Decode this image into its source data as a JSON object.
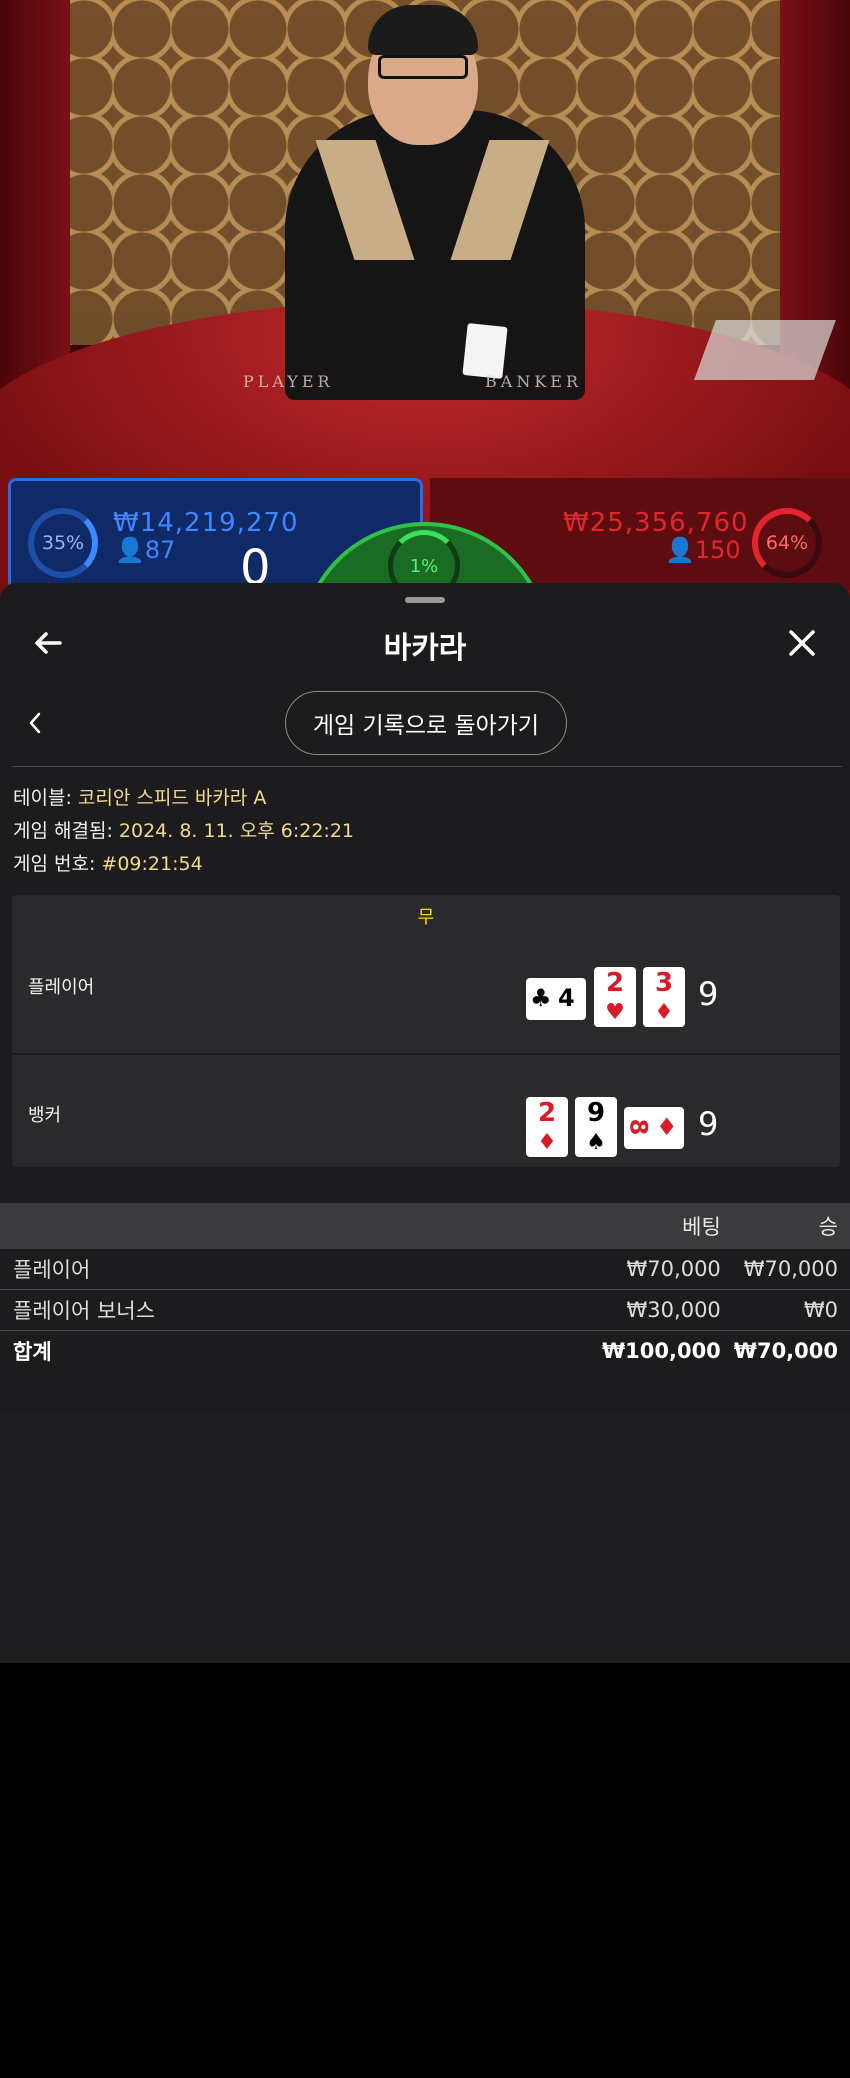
{
  "scene": {
    "felt_player": "PLAYER",
    "felt_banker": "BANKER"
  },
  "bet_strip": {
    "player_pct": "35%",
    "player_amount": "₩14,219,270",
    "player_count": "87",
    "player_score": "0",
    "tie_pct": "1%",
    "banker_amount": "₩25,356,760",
    "banker_count": "150",
    "banker_pct": "64%"
  },
  "sheet": {
    "title": "바카라",
    "back_history_label": "게임 기록으로 돌아가기",
    "meta": {
      "table_label": "테이블: ",
      "table_value": "코리안 스피드 바카라 A",
      "settled_label": "게임 해결됨: ",
      "settled_value": "2024. 8. 11. 오후 6:22:21",
      "game_no_label": "게임 번호: ",
      "game_no_value": "#09:21:54"
    },
    "result": {
      "outcome": "무",
      "player": {
        "name": "플레이어",
        "score": "9",
        "cards": [
          {
            "rank": "4",
            "suit": "♣",
            "color": "black",
            "orientation": "horizontal"
          },
          {
            "rank": "2",
            "suit": "♥",
            "color": "red",
            "orientation": "vertical"
          },
          {
            "rank": "3",
            "suit": "♦",
            "color": "red",
            "orientation": "vertical"
          }
        ]
      },
      "banker": {
        "name": "뱅커",
        "score": "9",
        "cards": [
          {
            "rank": "2",
            "suit": "♦",
            "color": "red",
            "orientation": "vertical"
          },
          {
            "rank": "9",
            "suit": "♠",
            "color": "black",
            "orientation": "vertical"
          },
          {
            "rank": "8",
            "suit": "♦",
            "color": "red",
            "orientation": "horizontal"
          }
        ]
      }
    },
    "bets_table": {
      "col_bet": "베팅",
      "col_win": "승",
      "rows": [
        {
          "label": "플레이어",
          "bet": "₩70,000",
          "win": "₩70,000"
        },
        {
          "label": "플레이어 보너스",
          "bet": "₩30,000",
          "win": "₩0"
        }
      ],
      "total": {
        "label": "합계",
        "bet": "₩100,000",
        "win": "₩70,000"
      }
    }
  }
}
